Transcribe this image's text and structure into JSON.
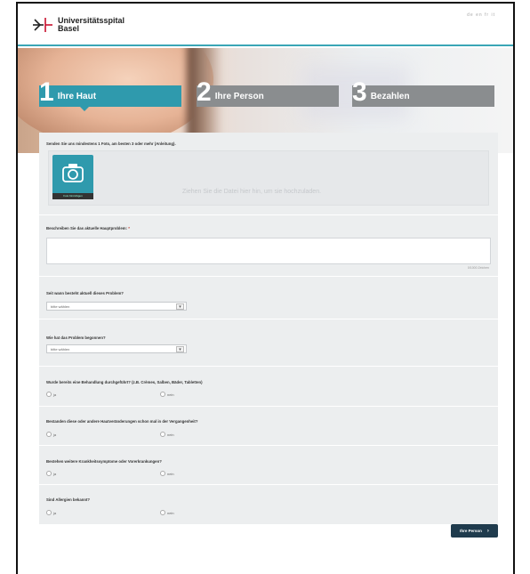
{
  "header": {
    "logo_line1": "Universitätsspital",
    "logo_line2": "Basel",
    "languages": "de en fr it"
  },
  "steps": [
    {
      "number": "1",
      "label": "Ihre Haut",
      "active": true
    },
    {
      "number": "2",
      "label": "Ihre Person",
      "active": false
    },
    {
      "number": "3",
      "label": "Bezahlen",
      "active": false
    }
  ],
  "upload": {
    "question": "Senden Sie uns mindestens 1 Foto, am besten 3 oder mehr (Anleitung).",
    "button_label": "Foto hinzufügen",
    "drop_hint": "Ziehen Sie die Datei hier hin, um sie hochzuladen."
  },
  "problem": {
    "question": "Beschreiben Sie das aktuelle Hauptproblem:",
    "required_mark": "*",
    "counter": "0/1000 Zeichen"
  },
  "since": {
    "question": "Seit wann besteht aktuell dieses Problem?",
    "select_value": "bitte wählen"
  },
  "began": {
    "question": "Wie hat das Problem begonnen?",
    "select_value": "bitte wählen"
  },
  "treatment": {
    "question": "Wurde bereits eine Behandlung durchgeführt? (z.B. Crèmes, Salben, Bäder, Tabletten)",
    "yes": "ja",
    "no": "nein"
  },
  "past": {
    "question": "Bestanden diese oder andere Hautveränderungen schon mal in der Vergangenheit?",
    "yes": "ja",
    "no": "nein"
  },
  "symptoms": {
    "question": "Bestehen weitere Krankheitssymptome oder Vorerkrankungen?",
    "yes": "ja",
    "no": "nein"
  },
  "allergies": {
    "question": "Sind Allergien bekannt?",
    "yes": "ja",
    "no": "nein"
  },
  "next_button": {
    "label": "Ihre Person",
    "chevron": "›"
  },
  "colors": {
    "accent": "#2f9aad",
    "inactive_step": "#8a8d8f",
    "button": "#1f3b4d",
    "logo_red": "#c8102e"
  }
}
